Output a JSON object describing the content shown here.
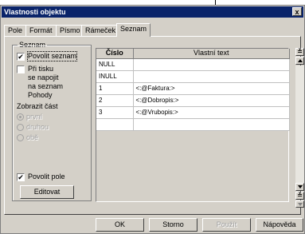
{
  "window": {
    "title": "Vlastnosti objektu",
    "close_glyph": "x"
  },
  "tabs": [
    {
      "label": "Pole"
    },
    {
      "label": "Formát"
    },
    {
      "label": "Písmo"
    },
    {
      "label": "Rámeček"
    },
    {
      "label": "Seznam",
      "active": true
    }
  ],
  "group": {
    "title": "Seznam",
    "enable_list": {
      "label": "Povolit seznam",
      "checked": true
    },
    "on_print": {
      "label": "Při tisku\nse napojit\nna seznam\nPohody",
      "checked": false
    },
    "show_part_label": "Zobrazit část",
    "radios": [
      {
        "label": "první",
        "selected": true
      },
      {
        "label": "druhou",
        "selected": false
      },
      {
        "label": "obě",
        "selected": false
      }
    ],
    "enable_field": {
      "label": "Povolit pole",
      "checked": true
    },
    "edit_button": "Editovat"
  },
  "table": {
    "headers": [
      "Číslo",
      "Vlastní text"
    ],
    "rows": [
      {
        "number": "NULL",
        "text": ""
      },
      {
        "number": "INULL",
        "text": ""
      },
      {
        "number": "1",
        "text": "<:@Faktura:>"
      },
      {
        "number": "2",
        "text": "<:@Dobropis:>"
      },
      {
        "number": "3",
        "text": "<:@Vrubopis:>"
      },
      {
        "number": "",
        "text": ""
      }
    ]
  },
  "scroll": {
    "top_glyph": "≚",
    "bottom_glyph": "≚"
  },
  "footer": {
    "ok": "OK",
    "cancel": "Storno",
    "apply": "Použít",
    "help": "Nápověda"
  },
  "check_glyph": "✔"
}
